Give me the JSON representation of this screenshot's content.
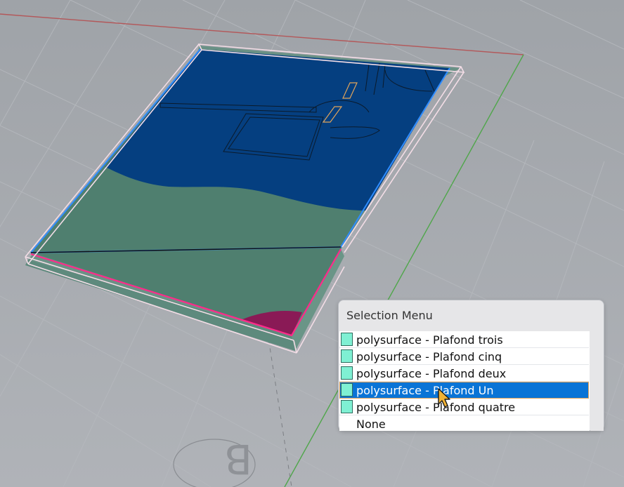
{
  "colors": {
    "background": "#a5a8ad",
    "swatch": "#7ff0d3",
    "highlight": "#0a74d6",
    "surface_blue": "#053f80",
    "surface_green": "#4f7f6f",
    "edge_magenta": "#ff2a8a",
    "edge_blue": "#2f8cff"
  },
  "viewport": {
    "watermark_letter": "B"
  },
  "selection_menu": {
    "title": "Selection Menu",
    "items": [
      {
        "label": "polysurface - Plafond trois",
        "swatch": true,
        "selected": false
      },
      {
        "label": "polysurface - Plafond cinq",
        "swatch": true,
        "selected": false
      },
      {
        "label": "polysurface - Plafond deux",
        "swatch": true,
        "selected": false
      },
      {
        "label": "polysurface - Plafond Un",
        "swatch": true,
        "selected": true
      },
      {
        "label": "polysurface - Plafond quatre",
        "swatch": true,
        "selected": false
      },
      {
        "label": "None",
        "swatch": false,
        "selected": false
      }
    ]
  },
  "icons": {
    "cursor": "arrow-cursor-icon"
  }
}
